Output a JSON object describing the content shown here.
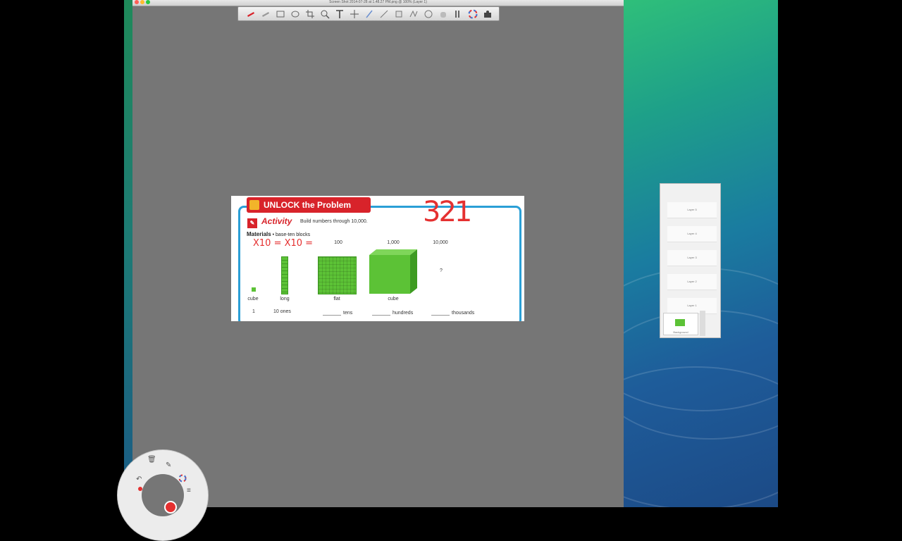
{
  "window": {
    "title": "Screen Shot 2014-07-28 at 1.48.27 PM.png @ 100% (Layer 1)",
    "traffic_lights": [
      "#ff5f57",
      "#febc2e",
      "#28c840"
    ]
  },
  "toolbar": {
    "tools": [
      "red-marker-icon",
      "highlighter-icon",
      "rectangle-icon",
      "ellipse-icon",
      "crop-icon",
      "zoom-icon",
      "text-icon",
      "move-icon",
      "pen-icon",
      "line-icon",
      "shape-icon",
      "lasso-icon",
      "select-icon",
      "hand-icon",
      "brush-icon",
      "color-wheel-icon",
      "stamp-icon"
    ]
  },
  "document": {
    "banner": "UNLOCK the Problem",
    "activity_title": "Activity",
    "activity_desc": "Build numbers through 10,000.",
    "materials_label": "Materials",
    "materials_text": "• base-ten blocks",
    "columns": [
      {
        "top": "1",
        "shape": "cube",
        "count": "10 ones"
      },
      {
        "top": "10",
        "shape": "long",
        "count": "tens"
      },
      {
        "top": "100",
        "shape": "flat",
        "count": "hundreds"
      },
      {
        "top": "1,000",
        "shape": "cube",
        "count": "thousands"
      },
      {
        "top": "10,000",
        "shape": "",
        "count": ""
      }
    ],
    "top_labels": [
      "100",
      "1,000",
      "10,000"
    ],
    "shape_labels": [
      "cube",
      "long",
      "flat",
      "cube"
    ],
    "question_mark": "?",
    "count_first": "1",
    "count_ones": "10 ones",
    "count_tens": "tens",
    "count_hundreds": "hundreds",
    "count_thousands": "thousands"
  },
  "annotations": {
    "handwritten_number": "321",
    "handwritten_expression": "X10 = X10 ="
  },
  "layers_panel": {
    "layers": [
      "Layer 5",
      "Layer 4",
      "Layer 3",
      "Layer 2",
      "Layer 1"
    ],
    "thumbnail_label": "Background"
  },
  "colors": {
    "canvas_bg": "#767676",
    "banner_red": "#d8232a",
    "frame_blue": "#2a9fd6",
    "block_green": "#5cc236",
    "ink_red": "#e53030"
  }
}
